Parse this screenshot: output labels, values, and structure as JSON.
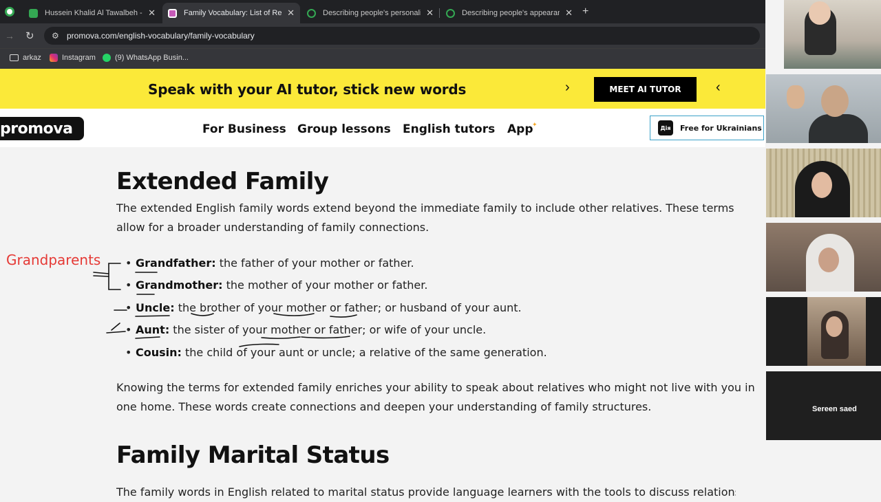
{
  "tabs": [
    {
      "title": "Hussein Khalid Al Tawalbeh - Go",
      "icon": "sheets-icon",
      "color": "#34a853",
      "active": false
    },
    {
      "title": "Family Vocabulary: List of Relat",
      "icon": "promova-favicon",
      "color": "#c65bb8",
      "active": true
    },
    {
      "title": "Describing people's personality",
      "icon": "check-circle-icon",
      "color": "#34a853",
      "active": false
    },
    {
      "title": "Describing people's appearance",
      "icon": "check-circle-icon",
      "color": "#34a853",
      "active": false
    }
  ],
  "address_bar": {
    "url": "promova.com/english-vocabulary/family-vocabulary"
  },
  "bookmarks": [
    "arkaz",
    "Instagram",
    "(9) WhatsApp Busin..."
  ],
  "promo": {
    "text": "Speak with your AI tutor, stick new words",
    "button": "MEET AI TUTOR"
  },
  "nav": {
    "logo": "promova",
    "links": [
      "For Business",
      "Group lessons",
      "English tutors",
      "App"
    ],
    "free_button": "Free for Ukrainians",
    "diia_label": "Дія"
  },
  "content": {
    "heading1": "Extended Family",
    "intro": "The extended English family words extend beyond the immediate family to include other relatives. These terms allow for a broader understanding of family connections.",
    "items": [
      {
        "term": "Grandfather:",
        "definition": " the father of your mother or father."
      },
      {
        "term": "Grandmother:",
        "definition": " the mother of your mother or father."
      },
      {
        "term": "Uncle:",
        "definition": " the brother of your mother or father; or husband of your aunt."
      },
      {
        "term": "Aunt:",
        "definition": " the sister of your mother or father; or wife of your uncle."
      },
      {
        "term": "Cousin:",
        "definition": " the child of your aunt or uncle; a relative of the same generation."
      }
    ],
    "outro": "Knowing the terms for extended family enriches your ability to speak about relatives who might not live with you in one home. These words create connections and deepen your understanding of family structures.",
    "heading2": "Family Marital Status",
    "partial": "The family words in English related to marital status provide language learners with the tools to discuss relationships"
  },
  "annotation": {
    "text": "Grandparents",
    "color": "#e53935"
  },
  "video": {
    "participant_name": "Sereen saed"
  },
  "colors": {
    "promo_yellow": "#fbe939",
    "accent_blue": "#3aa0c8"
  }
}
